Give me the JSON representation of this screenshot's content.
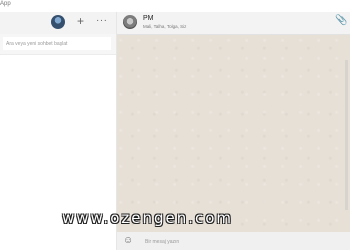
{
  "app": {
    "title": "App"
  },
  "left_panel": {
    "plus_icon": "+",
    "menu_icon": "···",
    "search": {
      "placeholder": "Ara veya yeni sohbet başlat"
    }
  },
  "chat": {
    "name": "PM",
    "participants": "Mali, Talha, Tolga, Siz",
    "attach_icon": "📎",
    "emoji_icon": "☺",
    "message_placeholder": "Bir mesaj yazın"
  },
  "watermark": "www.ozengen.com",
  "colors": {
    "chat_background": "#e6dfd6",
    "header_background": "#f3f3f3"
  }
}
